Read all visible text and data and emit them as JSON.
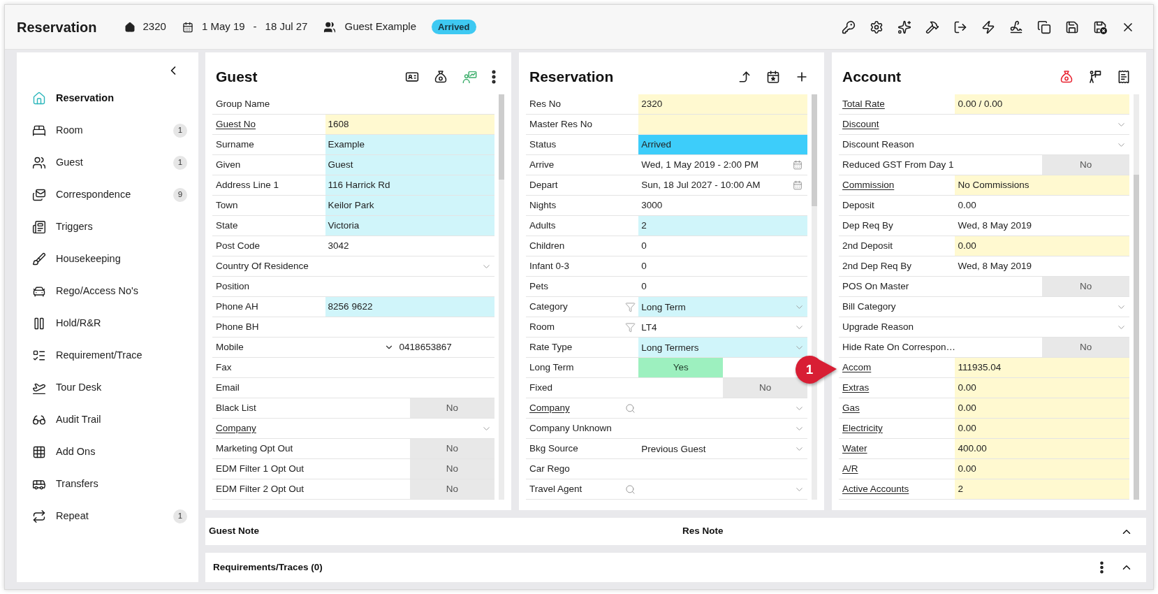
{
  "header": {
    "title": "Reservation",
    "res_no": "2320",
    "date_from": "1 May 19",
    "date_separator": "-",
    "date_to": "18 Jul 27",
    "guest_name": "Guest Example",
    "status": "Arrived"
  },
  "sidebar": {
    "items": [
      {
        "label": "Reservation",
        "selected": true
      },
      {
        "label": "Room",
        "count": "1",
        "selected": false
      },
      {
        "label": "Guest",
        "count": "1",
        "selected": false
      },
      {
        "label": "Correspondence",
        "count": "9",
        "selected": false
      },
      {
        "label": "Triggers",
        "selected": false
      },
      {
        "label": "Housekeeping",
        "selected": false
      },
      {
        "label": "Rego/Access No's",
        "selected": false
      },
      {
        "label": "Hold/R&R",
        "selected": false
      },
      {
        "label": "Requirement/Trace",
        "selected": false
      },
      {
        "label": "Tour Desk",
        "selected": false
      },
      {
        "label": "Audit Trail",
        "selected": false
      },
      {
        "label": "Add Ons",
        "selected": false
      },
      {
        "label": "Transfers",
        "selected": false
      },
      {
        "label": "Repeat",
        "count": "1",
        "selected": false
      }
    ]
  },
  "panels": [
    {
      "kind": "guest",
      "title": "Guest",
      "rows": [
        {
          "kind": "text",
          "label": "Group Name",
          "link": false
        },
        {
          "kind": "text",
          "label": "Guest No",
          "link": true,
          "value": "1608",
          "color": "#fff9d0"
        },
        {
          "kind": "text",
          "label": "Surname",
          "link": false,
          "value": "Example",
          "color": "#d0f5fa"
        },
        {
          "kind": "text",
          "label": "Given",
          "link": false,
          "value": "Guest",
          "color": "#d0f5fa"
        },
        {
          "kind": "text",
          "label": "Address Line 1",
          "link": false,
          "value": "116 Harrick Rd",
          "color": "#d0f5fa"
        },
        {
          "kind": "text",
          "label": "Town",
          "link": false,
          "value": "Keilor Park",
          "color": "#d0f5fa"
        },
        {
          "kind": "text",
          "label": "State",
          "link": false,
          "value": "Victoria",
          "color": "#d0f5fa"
        },
        {
          "kind": "text",
          "label": "Post Code",
          "link": false,
          "value": "3042"
        },
        {
          "kind": "select",
          "label": "Country Of Residence",
          "link": false
        },
        {
          "kind": "text",
          "label": "Position",
          "link": false
        },
        {
          "kind": "text",
          "label": "Phone AH",
          "link": false,
          "value": "8256 9622",
          "color": "#d0f5fa"
        },
        {
          "kind": "text",
          "label": "Phone BH",
          "link": false
        },
        {
          "kind": "phone",
          "label": "Mobile",
          "link": false,
          "value": "0418653867"
        },
        {
          "kind": "text",
          "label": "Fax",
          "link": false
        },
        {
          "kind": "text",
          "label": "Email",
          "link": false
        },
        {
          "kind": "toggle",
          "label": "Black List",
          "link": false,
          "value": "No",
          "on": false
        },
        {
          "kind": "select",
          "label": "Company",
          "link": true
        },
        {
          "kind": "toggle",
          "label": "Marketing Opt Out",
          "link": false,
          "value": "No",
          "on": false
        },
        {
          "kind": "toggle",
          "label": "EDM Filter 1 Opt Out",
          "link": false,
          "value": "No",
          "on": false
        },
        {
          "kind": "toggle",
          "label": "EDM Filter 2 Opt Out",
          "link": false,
          "value": "No",
          "on": false
        }
      ]
    },
    {
      "kind": "reservation",
      "title": "Reservation",
      "rows": [
        {
          "kind": "text",
          "label": "Res No",
          "link": false,
          "value": "2320",
          "color": "#fff9d0"
        },
        {
          "kind": "text",
          "label": "Master Res No",
          "link": false,
          "color": "#fff9d0"
        },
        {
          "kind": "text",
          "label": "Status",
          "link": false,
          "value": "Arrived",
          "color": "#3dcdfa"
        },
        {
          "kind": "date",
          "label": "Arrive",
          "link": false,
          "value": "Wed, 1 May 2019 - 2:00 PM"
        },
        {
          "kind": "date",
          "label": "Depart",
          "link": false,
          "value": "Sun, 18 Jul 2027 - 10:00 AM"
        },
        {
          "kind": "text",
          "label": "Nights",
          "link": false,
          "value": "3000"
        },
        {
          "kind": "text",
          "label": "Adults",
          "link": false,
          "value": "2",
          "color": "#d0f5fa"
        },
        {
          "kind": "text",
          "label": "Children",
          "link": false,
          "value": "0"
        },
        {
          "kind": "text",
          "label": "Infant 0-3",
          "link": false,
          "value": "0"
        },
        {
          "kind": "text",
          "label": "Pets",
          "link": false,
          "value": "0"
        },
        {
          "kind": "filtered",
          "label": "Category",
          "link": false,
          "value": "Long Term",
          "color": "#d0f5fa"
        },
        {
          "kind": "filtered",
          "label": "Room",
          "link": false,
          "value": "LT4"
        },
        {
          "kind": "select",
          "label": "Rate Type",
          "link": false,
          "value": "Long Termers",
          "color": "#d0f5fa"
        },
        {
          "kind": "toggle",
          "label": "Long Term",
          "link": false,
          "value": "Yes",
          "on": true
        },
        {
          "kind": "toggle",
          "label": "Fixed",
          "link": false,
          "value": "No",
          "on": false
        },
        {
          "kind": "lookup",
          "label": "Company",
          "link": true
        },
        {
          "kind": "select",
          "label": "Company Unknown",
          "link": false
        },
        {
          "kind": "select",
          "label": "Bkg Source",
          "link": false,
          "value": "Previous Guest"
        },
        {
          "kind": "text",
          "label": "Car Rego",
          "link": false
        },
        {
          "kind": "lookup",
          "label": "Travel Agent",
          "link": false
        }
      ]
    },
    {
      "kind": "account",
      "title": "Account",
      "rows": [
        {
          "kind": "text",
          "label": "Total Rate",
          "link": true,
          "value": "0.00 / 0.00",
          "color": "#fff9d0"
        },
        {
          "kind": "select",
          "label": "Discount",
          "link": true
        },
        {
          "kind": "select",
          "label": "Discount Reason",
          "link": false
        },
        {
          "kind": "toggle",
          "label": "Reduced GST From Day 1",
          "link": false,
          "value": "No",
          "on": false
        },
        {
          "kind": "text",
          "label": "Commission",
          "link": true,
          "value": "No Commissions",
          "color": "#fff9d0"
        },
        {
          "kind": "text",
          "label": "Deposit",
          "link": false,
          "value": "0.00"
        },
        {
          "kind": "text",
          "label": "Dep Req By",
          "link": false,
          "value": "Wed, 8 May 2019"
        },
        {
          "kind": "text",
          "label": "2nd Deposit",
          "link": false,
          "value": "0.00",
          "color": "#fff9d0"
        },
        {
          "kind": "text",
          "label": "2nd Dep Req By",
          "link": false,
          "value": "Wed, 8 May 2019"
        },
        {
          "kind": "toggle",
          "label": "POS On Master",
          "link": false,
          "value": "No",
          "on": false
        },
        {
          "kind": "select",
          "label": "Bill Category",
          "link": false
        },
        {
          "kind": "select",
          "label": "Upgrade Reason",
          "link": false
        },
        {
          "kind": "toggle",
          "label": "Hide Rate On Correspon…",
          "link": false,
          "value": "No",
          "on": false
        },
        {
          "kind": "text",
          "label": "Accom",
          "link": true,
          "value": "111935.04",
          "color": "#fff9d0"
        },
        {
          "kind": "text",
          "label": "Extras",
          "link": true,
          "value": "0.00",
          "color": "#fff9d0"
        },
        {
          "kind": "text",
          "label": "Gas",
          "link": true,
          "value": "0.00",
          "color": "#fff9d0"
        },
        {
          "kind": "text",
          "label": "Electricity",
          "link": true,
          "value": "0.00",
          "color": "#fff9d0"
        },
        {
          "kind": "text",
          "label": "Water",
          "link": true,
          "value": "400.00",
          "color": "#fff9d0"
        },
        {
          "kind": "text",
          "label": "A/R",
          "link": true,
          "value": "0.00",
          "color": "#fff9d0"
        },
        {
          "kind": "text",
          "label": "Active Accounts",
          "link": true,
          "value": "2",
          "color": "#fff9d0"
        }
      ]
    }
  ],
  "notes_bar": {
    "guest_note": "Guest Note",
    "res_note": "Res Note"
  },
  "requirements_bar": {
    "title": "Requirements/Traces (0)"
  },
  "callout": {
    "label": "1"
  }
}
